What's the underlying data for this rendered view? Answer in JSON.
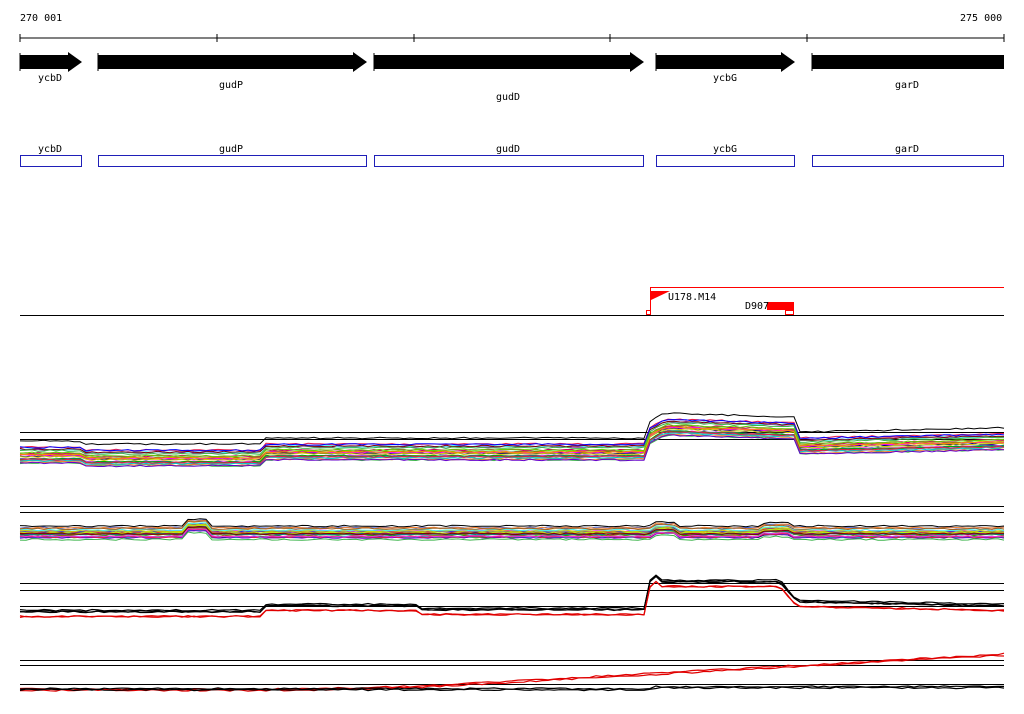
{
  "ruler": {
    "start_label": "270 001",
    "end_label": "275 000"
  },
  "genes": [
    {
      "name": "ycbD"
    },
    {
      "name": "gudP"
    },
    {
      "name": "gudD"
    },
    {
      "name": "ycbG"
    },
    {
      "name": "garD"
    }
  ],
  "cds": [
    {
      "name": "ycbD"
    },
    {
      "name": "gudP"
    },
    {
      "name": "gudD"
    },
    {
      "name": "ycbG"
    },
    {
      "name": "garD"
    }
  ],
  "features": {
    "primer_label": "U178.M14",
    "site_label": "D907"
  },
  "colors": {
    "arrow_fill": "#000000",
    "cds_outline": "#1f1fb8",
    "feature_red": "#ff0000",
    "trace_black": "#000000",
    "trace_red": "#e00000"
  }
}
